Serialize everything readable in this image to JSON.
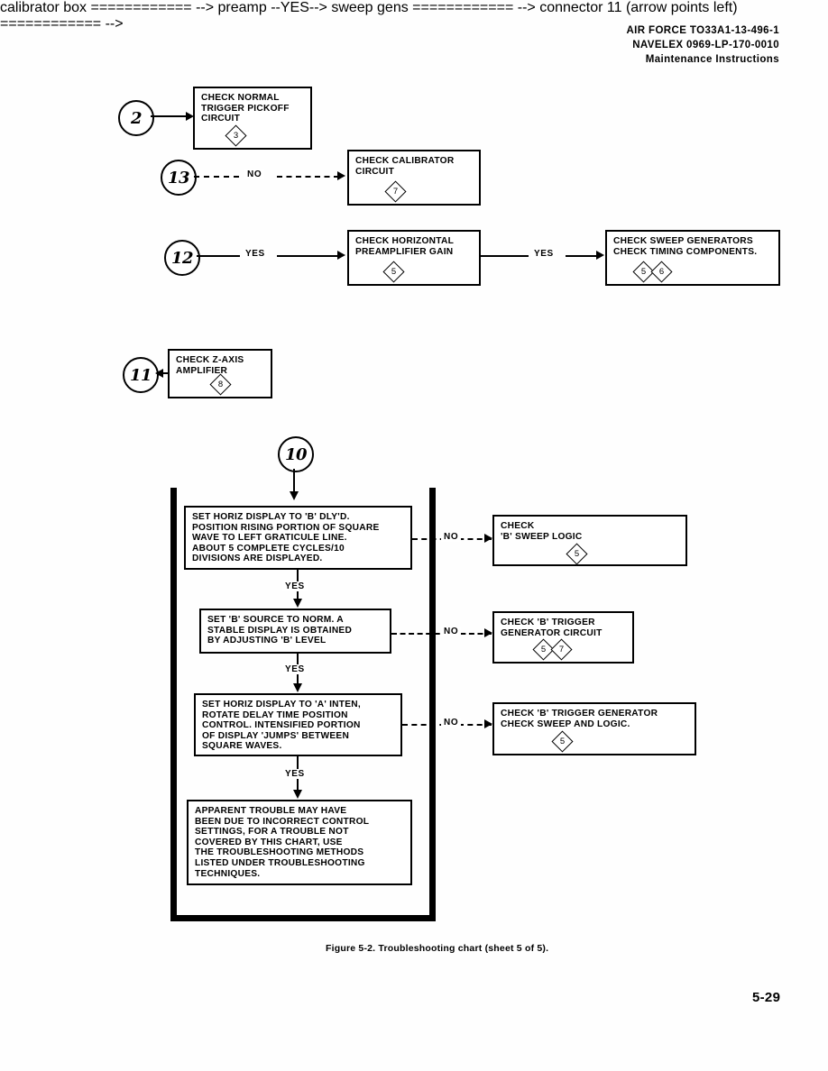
{
  "header": {
    "line1": "AIR FORCE  TO33A1-13-496-1",
    "line2": "NAVELEX  0969-LP-170-0010",
    "line3": "Maintenance Instructions"
  },
  "connectors": {
    "c2": "2",
    "c13": "13",
    "c12": "12",
    "c11": "11",
    "c10": "10"
  },
  "labels": {
    "no": "NO",
    "yes": "YES"
  },
  "boxes": {
    "normal_trigger": {
      "text": "CHECK NORMAL\nTRIGGER PICKOFF\nCIRCUIT",
      "refs": [
        "3"
      ]
    },
    "calibrator": {
      "text": "CHECK CALIBRATOR\nCIRCUIT",
      "refs": [
        "7"
      ]
    },
    "horiz_preamp": {
      "text": "CHECK HORIZONTAL\nPREAMPLIFIER GAIN",
      "refs": [
        "5"
      ]
    },
    "sweep_generators": {
      "text": "CHECK SWEEP GENERATORS\nCHECK TIMING COMPONENTS.",
      "refs": [
        "5",
        "6"
      ]
    },
    "z_axis": {
      "text": "CHECK Z-AXIS\nAMPLIFIER",
      "refs": [
        "8"
      ]
    },
    "step1": {
      "text": "SET HORIZ DISPLAY TO 'B' DLY'D.\nPOSITION RISING PORTION OF SQUARE\nWAVE TO LEFT GRATICULE LINE.\nABOUT 5 COMPLETE CYCLES/10\nDIVISIONS ARE DISPLAYED.",
      "refs": []
    },
    "step1_no": {
      "text": "CHECK\n     'B' SWEEP LOGIC",
      "refs": [
        "5"
      ]
    },
    "step2": {
      "text": "SET 'B' SOURCE TO NORM.  A\nSTABLE DISPLAY IS OBTAINED\nBY ADJUSTING 'B' LEVEL",
      "refs": []
    },
    "step2_no": {
      "text": "CHECK 'B' TRIGGER\nGENERATOR CIRCUIT",
      "refs": [
        "5",
        "7"
      ]
    },
    "step3": {
      "text": "SET HORIZ DISPLAY TO 'A' INTEN,\nROTATE DELAY TIME POSITION\nCONTROL.  INTENSIFIED PORTION\nOF DISPLAY 'JUMPS' BETWEEN\nSQUARE WAVES.",
      "refs": []
    },
    "step3_no": {
      "text": "CHECK 'B' TRIGGER GENERATOR\nCHECK SWEEP AND LOGIC.",
      "refs": [
        "5"
      ]
    },
    "conclusion": {
      "text": "APPARENT TROUBLE MAY HAVE\nBEEN DUE TO INCORRECT CONTROL\nSETTINGS, FOR A TROUBLE NOT\nCOVERED BY THIS CHART, USE\nTHE TROUBLESHOOTING METHODS\nLISTED UNDER TROUBLESHOOTING\nTECHNIQUES.",
      "refs": []
    }
  },
  "caption": "Figure 5-2. Troubleshooting chart (sheet 5 of 5).",
  "folio": "5-29"
}
